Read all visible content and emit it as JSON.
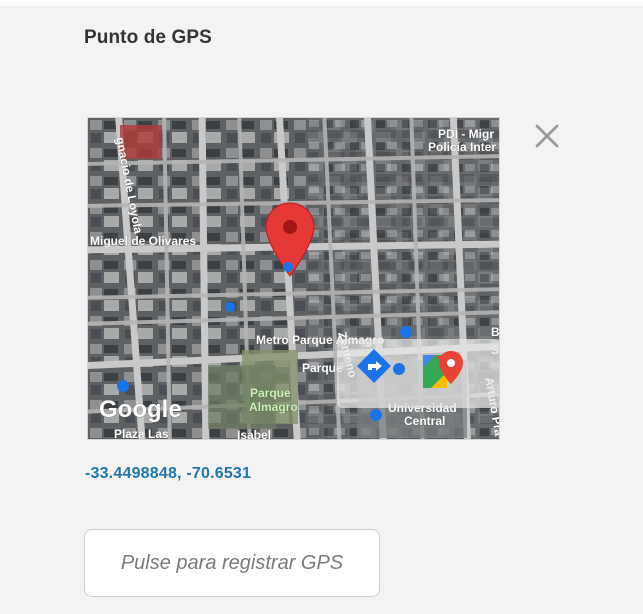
{
  "title": "Punto de GPS",
  "close_button": {
    "icon": "close-icon"
  },
  "map": {
    "provider": "Google",
    "labels": {
      "street_1": "Miguel de Olivares",
      "street_2": "Zenteno",
      "street_3": "gnacio de Loyola",
      "park_1": "Metro Parque Almagro",
      "park_2": "Parque",
      "park_3": "Parque",
      "park_4": "Almagro",
      "station_1": "PDI - Migr",
      "station_2": "Policía Inter",
      "university_1": "Universidad",
      "university_2": "Central",
      "plaza": "Plaza Las",
      "street_4": "Arturo Pra",
      "street_5": "Isabel",
      "fragment_1": "B",
      "fragment_2": "S"
    },
    "icons": [
      "location-pin-icon",
      "directions-icon",
      "google-maps-icon"
    ]
  },
  "coordinates": "-33.4498848, -70.6531",
  "gps_button_label": "Pulse para registrar GPS",
  "colors": {
    "accent": "#1f78a8",
    "pin": "#e53935",
    "directions": "#1a73e8"
  }
}
